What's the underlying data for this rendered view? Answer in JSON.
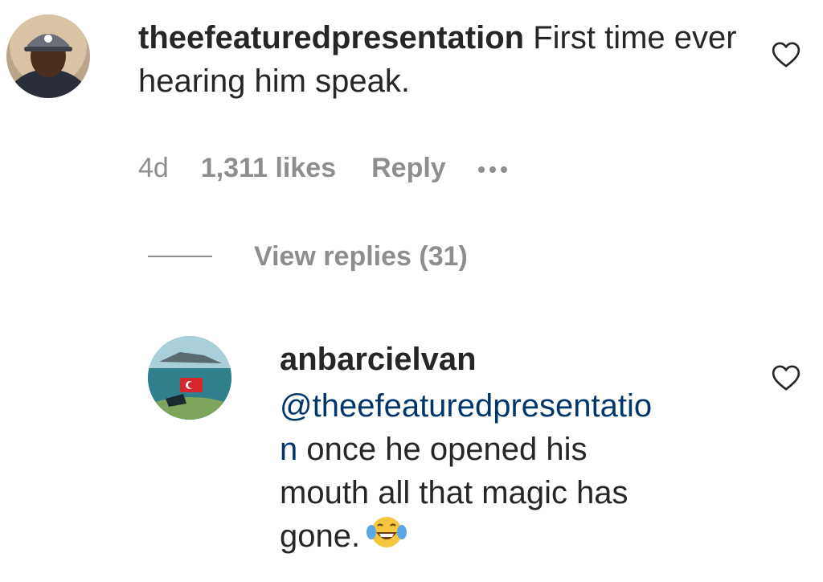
{
  "comment": {
    "username": "theefeaturedpresentation",
    "text": " First time ever hearing him speak.",
    "timestamp": "4d",
    "likes": "1,311 likes",
    "reply_label": "Reply",
    "more_icon": "ellipsis-icon",
    "heart_icon": "heart-outline-icon",
    "view_replies_label": "View replies (31)"
  },
  "reply": {
    "username": "anbarcielvan",
    "mention_line1": "@theefeaturedpresentatio",
    "mention_line2": "n",
    "text_line2": " once he opened his",
    "text_line3": "mouth all that magic has",
    "text_line4": "gone.",
    "emoji": "face-with-tears-of-joy",
    "heart_icon": "heart-outline-icon"
  },
  "colors": {
    "text": "#262626",
    "secondary": "#8e8e8e",
    "mention": "#00376b",
    "emoji": "#f7c640"
  }
}
